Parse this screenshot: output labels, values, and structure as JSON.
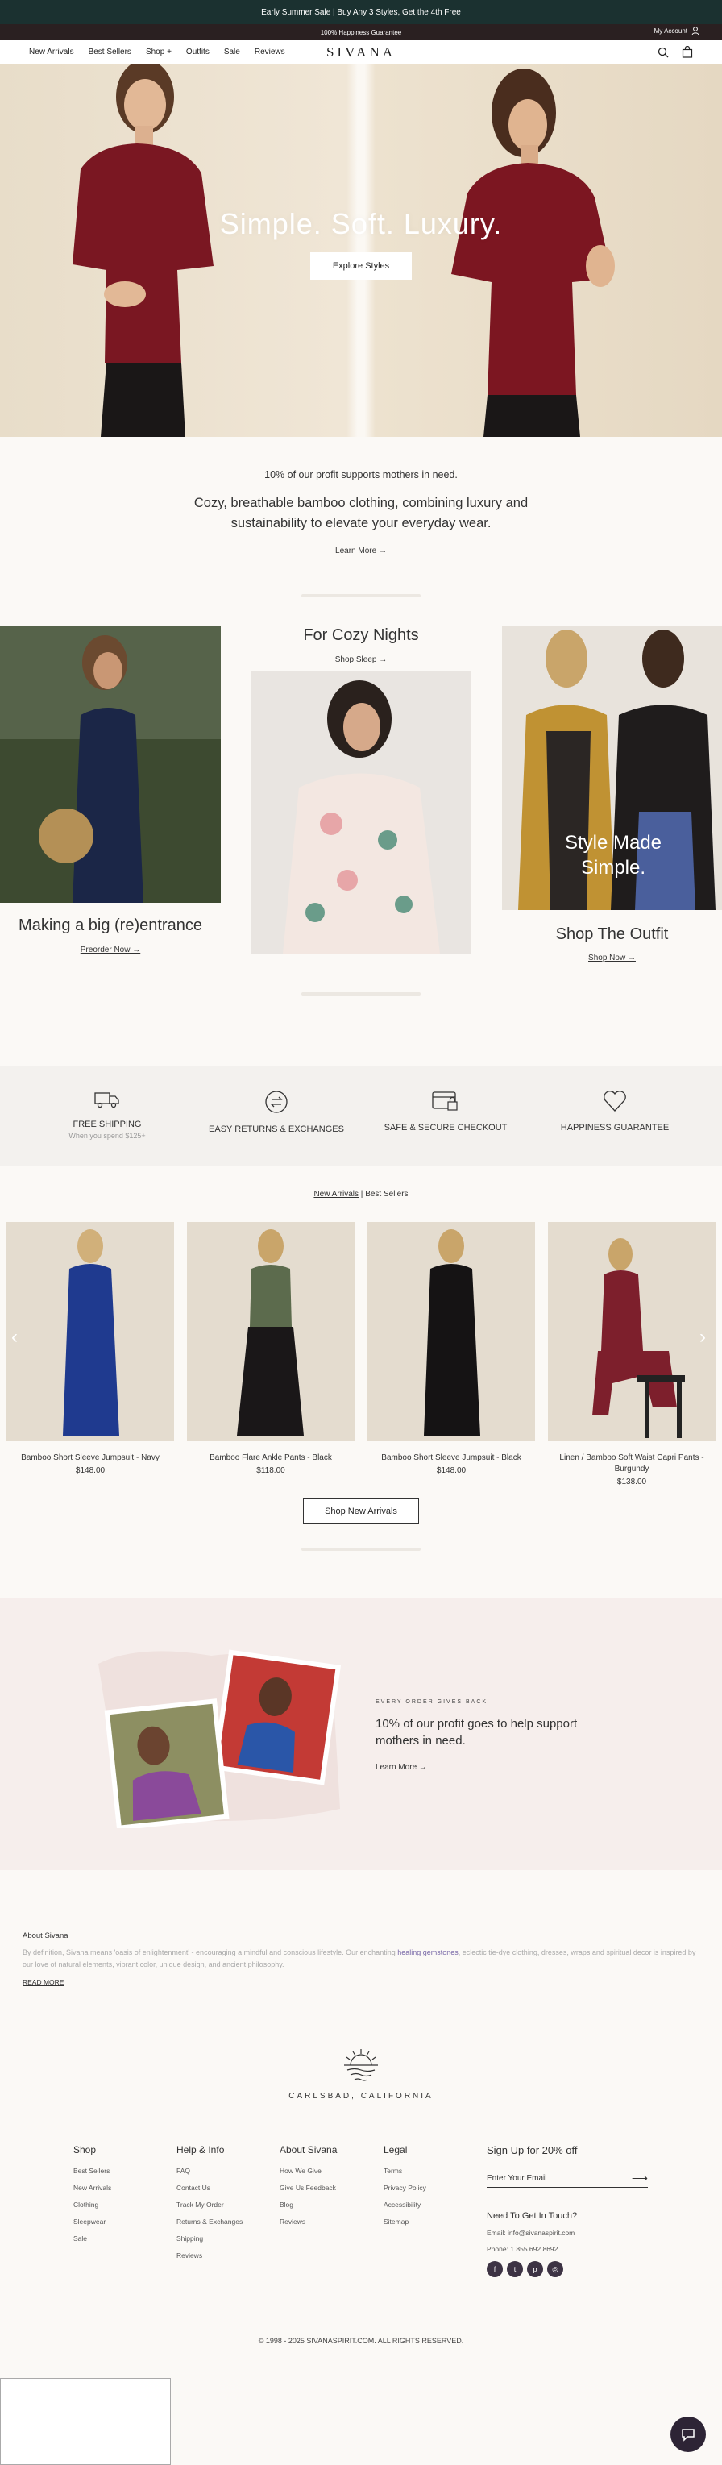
{
  "announcement": {
    "top": "Early Summer Sale | Buy Any 3 Styles, Get the 4th Free",
    "second": "100% Happiness Guarantee",
    "account": "My Account"
  },
  "nav": {
    "links": [
      "New Arrivals",
      "Best Sellers",
      "Shop +",
      "Outfits",
      "Sale",
      "Reviews"
    ],
    "logo": "SIVANA"
  },
  "hero": {
    "title": "Simple. Soft. Luxury.",
    "cta": "Explore Styles"
  },
  "mission": {
    "small": "10% of our profit supports mothers in need.",
    "big": "Cozy, breathable bamboo clothing, combining luxury and sustainability to elevate your everyday wear.",
    "learn": "Learn More →"
  },
  "collections": [
    {
      "title": "Making a big (re)entrance",
      "link": "Preorder Now →"
    },
    {
      "title": "For Cozy Nights",
      "link": "Shop Sleep →"
    },
    {
      "title": "Shop The Outfit",
      "link": "Shop Now →",
      "overlay": "Style Made Simple."
    }
  ],
  "benefits": [
    {
      "label": "FREE SHIPPING",
      "sub": "When you spend $125+"
    },
    {
      "label": "EASY RETURNS & EXCHANGES",
      "sub": ""
    },
    {
      "label": "SAFE & SECURE CHECKOUT",
      "sub": ""
    },
    {
      "label": "HAPPINESS GUARANTEE",
      "sub": ""
    }
  ],
  "product_tabs": {
    "active": "New Arrivals",
    "sep": "|",
    "other": "Best Sellers"
  },
  "products": [
    {
      "name": "Bamboo Short Sleeve Jumpsuit - Navy",
      "price": "$148.00",
      "color": "#1f3a8f"
    },
    {
      "name": "Bamboo Flare Ankle Pants - Black",
      "price": "$118.00",
      "color": "#1a1718"
    },
    {
      "name": "Bamboo Short Sleeve Jumpsuit - Black",
      "price": "$148.00",
      "color": "#151314"
    },
    {
      "name": "Linen / Bamboo Soft Waist Capri Pants - Burgundy",
      "price": "$138.00",
      "color": "#7d1f2c"
    }
  ],
  "shop_new": "Shop New Arrivals",
  "giveback": {
    "eyebrow": "EVERY ORDER GIVES BACK",
    "head": "10% of our profit goes to help support mothers in need.",
    "link": "Learn More →"
  },
  "about": {
    "heading": "About Sivana",
    "text_before": "By definition, Sivana means 'oasis of enlightenment' - encouraging a mindful and conscious lifestyle. Our enchanting ",
    "text_link": "healing gemstones",
    "text_after": ", eclectic tie-dye clothing, dresses, wraps and spiritual decor is inspired by our love of natural elements, vibrant color, unique design, and ancient philosophy.",
    "read_more": "READ MORE"
  },
  "footer": {
    "location": "CARLSBAD, CALIFORNIA",
    "columns": [
      {
        "title": "Shop",
        "items": [
          "Best Sellers",
          "New Arrivals",
          "Clothing",
          "Sleepwear",
          "Sale"
        ]
      },
      {
        "title": "Help & Info",
        "items": [
          "FAQ",
          "Contact Us",
          "Track My Order",
          "Returns & Exchanges",
          "Shipping",
          "Reviews"
        ]
      },
      {
        "title": "About Sivana",
        "items": [
          "How We Give",
          "Give Us Feedback",
          "Blog",
          "Reviews"
        ]
      },
      {
        "title": "Legal",
        "items": [
          "Terms",
          "Privacy Policy",
          "Accessibility",
          "Sitemap"
        ]
      }
    ],
    "signup_title": "Sign Up for 20% off",
    "email_placeholder": "Enter Your Email",
    "touch_title": "Need To Get In Touch?",
    "email": "Email: info@sivanaspirit.com",
    "phone": "Phone: 1.855.692.8692",
    "copyright": "© 1998 - 2025 SIVANASPIRIT.COM. ALL RIGHTS RESERVED."
  }
}
